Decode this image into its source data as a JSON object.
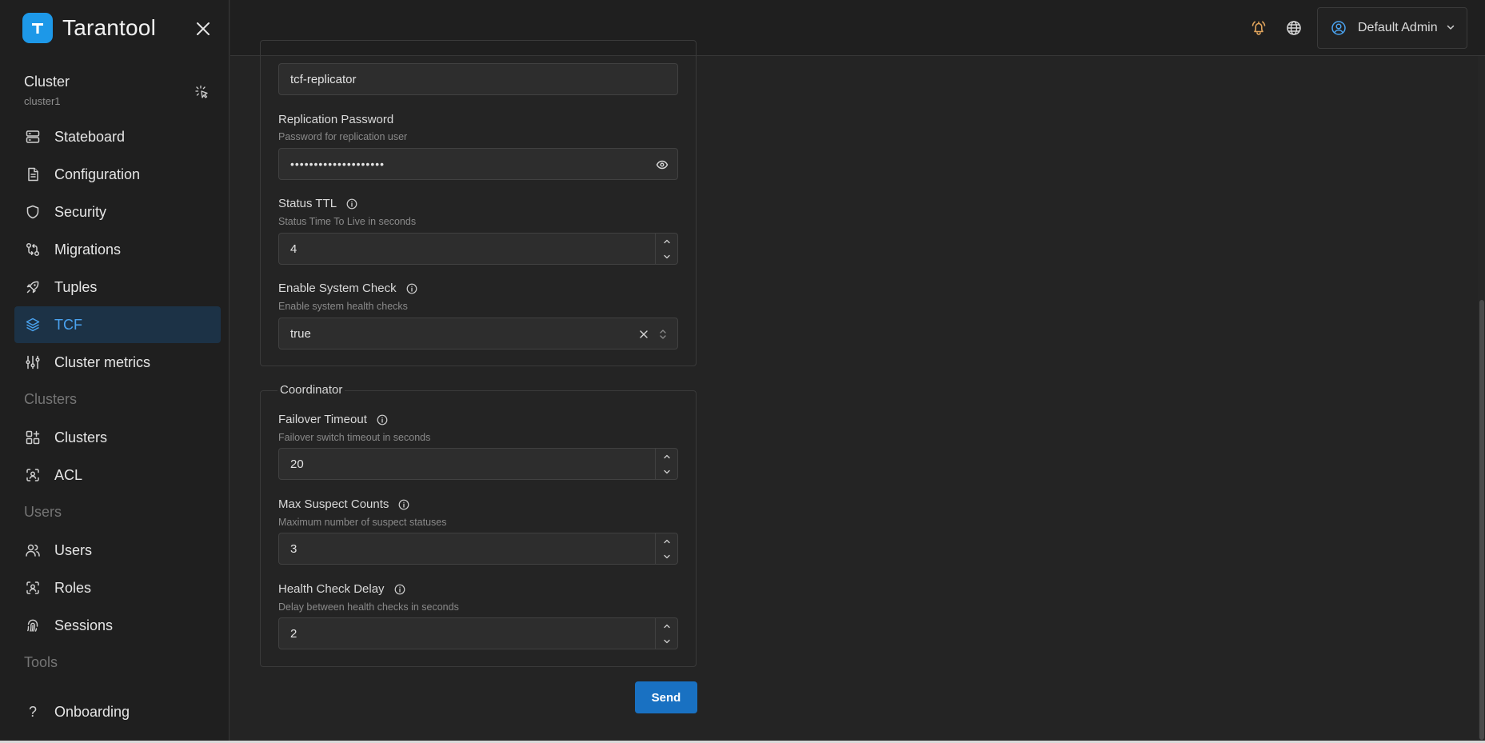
{
  "app": {
    "name": "Tarantool"
  },
  "cluster": {
    "title": "Cluster",
    "subtitle": "cluster1"
  },
  "nav": {
    "stateboard": "Stateboard",
    "configuration": "Configuration",
    "security": "Security",
    "migrations": "Migrations",
    "tuples": "Tuples",
    "tcf": "TCF",
    "cluster_metrics": "Cluster metrics",
    "section_clusters": "Clusters",
    "clusters": "Clusters",
    "acl": "ACL",
    "section_users": "Users",
    "users": "Users",
    "roles": "Roles",
    "sessions": "Sessions",
    "section_tools": "Tools",
    "onboarding": "Onboarding",
    "onboarding_glyph": "?"
  },
  "header": {
    "user_name": "Default Admin"
  },
  "colors": {
    "accent": "#1971c2",
    "active_bg": "#1c3246",
    "active_text": "#4aa3f0",
    "bell": "#e0a45c",
    "logo": "#1d98e8"
  },
  "form": {
    "replication_user": {
      "value": "tcf-replicator"
    },
    "replication_password": {
      "label": "Replication Password",
      "description": "Password for replication user",
      "value": "••••••••••••••••••••"
    },
    "status_ttl": {
      "label": "Status TTL",
      "description": "Status Time To Live in seconds",
      "value": "4"
    },
    "enable_system_check": {
      "label": "Enable System Check",
      "description": "Enable system health checks",
      "value": "true"
    },
    "coordinator": {
      "legend": "Coordinator",
      "failover_timeout": {
        "label": "Failover Timeout",
        "description": "Failover switch timeout in seconds",
        "value": "20"
      },
      "max_suspect_counts": {
        "label": "Max Suspect Counts",
        "description": "Maximum number of suspect statuses",
        "value": "3"
      },
      "health_check_delay": {
        "label": "Health Check Delay",
        "description": "Delay between health checks in seconds",
        "value": "2"
      }
    },
    "send_label": "Send"
  }
}
